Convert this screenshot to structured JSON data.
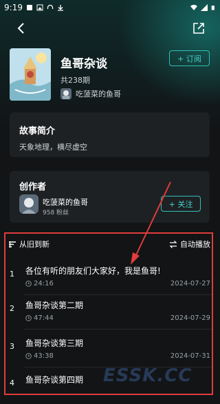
{
  "status_bar": {
    "time": "9:19"
  },
  "album": {
    "title": "鱼哥杂谈",
    "episode_count": "共238期",
    "author": "吃菠菜的鱼哥",
    "subscribe_label": "+ 订阅"
  },
  "intro": {
    "heading": "故事简介",
    "text": "天象地理，横尽虚空"
  },
  "creator": {
    "heading": "创作者",
    "name": "吃菠菜的鱼哥",
    "fans": "958 粉丝",
    "follow_label": "+ 关注"
  },
  "sort_bar": {
    "order_label": "从旧到新",
    "autoplay_label": "自动播放"
  },
  "episodes": [
    {
      "index": "1",
      "title": "各位有听的朋友们大家好，我是鱼哥!",
      "duration": "24:16",
      "date": "2024-07-27"
    },
    {
      "index": "2",
      "title": "鱼哥杂谈第二期",
      "duration": "47:44",
      "date": "2024-07-29"
    },
    {
      "index": "3",
      "title": "鱼哥杂谈第三期",
      "duration": "43:38",
      "date": "2024-07-31"
    },
    {
      "index": "4",
      "title": "鱼哥杂谈第四期",
      "duration": "",
      "date": ""
    }
  ],
  "watermark": "ESSK.CC",
  "colors": {
    "accent": "#2fc0b5",
    "annotation": "#e23c3c",
    "background": "#121416",
    "card": "#1e2124"
  }
}
